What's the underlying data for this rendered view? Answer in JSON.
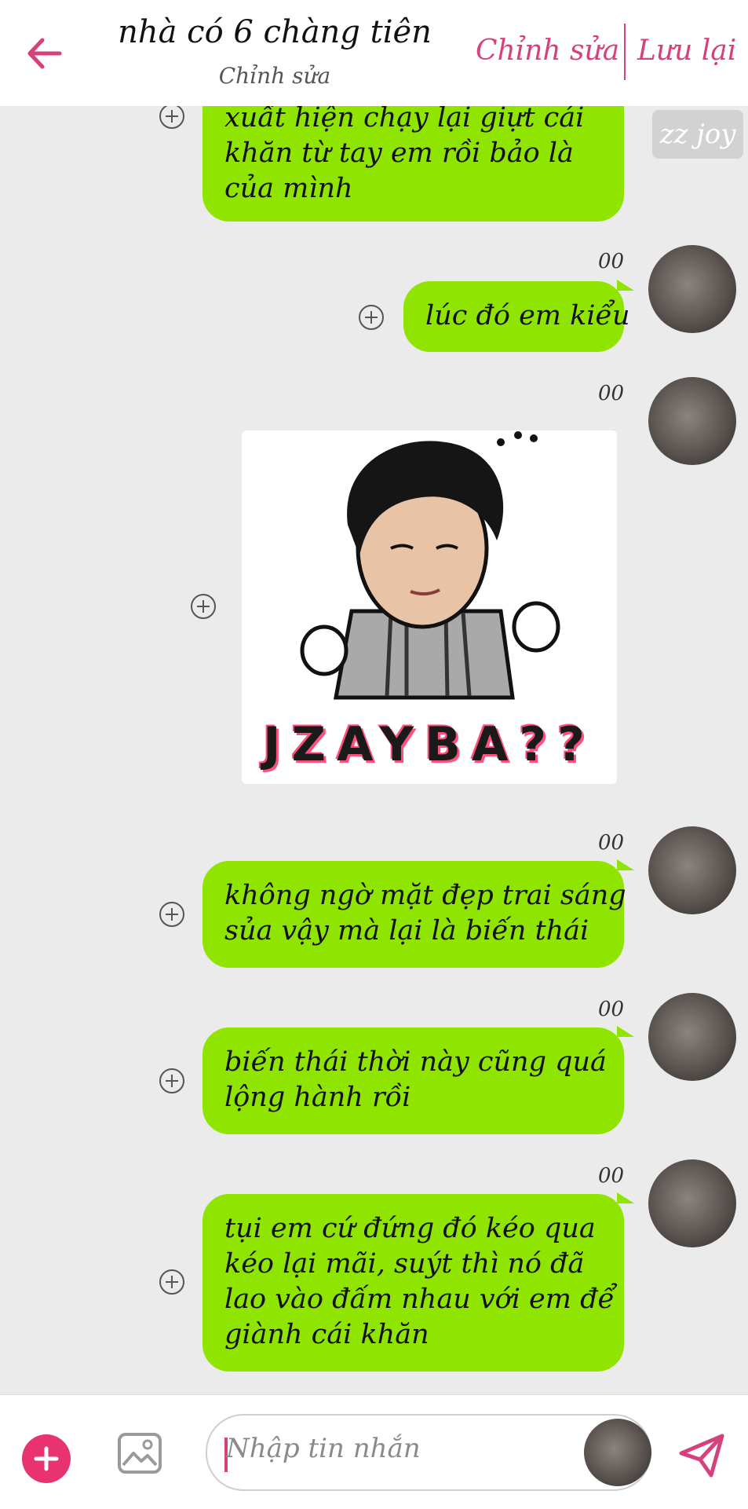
{
  "header": {
    "title": "nhà có 6 chàng tiên",
    "subtitle": "Chỉnh sửa",
    "edit_label": "Chỉnh sửa",
    "save_label": "Lưu lại",
    "accent_color": "#d6417d"
  },
  "sender_tag": "zz joy",
  "messages": [
    {
      "lines": [
        "xuất hiện chạy lại giựt cái",
        "khăn từ tay em rồi bảo là",
        "của mình"
      ]
    },
    {
      "time": "00",
      "lines": [
        "lúc đó em kiểu"
      ]
    },
    {
      "time": "00",
      "sticker_caption": "JZAYBA??"
    },
    {
      "time": "00",
      "lines": [
        "không ngờ mặt đẹp trai sáng",
        "sủa vậy mà lại là biến thái"
      ]
    },
    {
      "time": "00",
      "lines": [
        "biến thái thời này cũng quá",
        "lộng hành rồi"
      ]
    },
    {
      "time": "00",
      "lines": [
        "tụi em cứ đứng đó kéo qua",
        "kéo lại mãi, suýt thì nó đã",
        "lao vào đấm nhau với em để",
        "giành cái khăn"
      ]
    }
  ],
  "composer": {
    "placeholder": "Nhập tin nhắn"
  },
  "colors": {
    "bubble": "#8fe400",
    "background": "#ebebeb",
    "add_button": "#e83370"
  },
  "icons": [
    "back-arrow-icon",
    "add-icon",
    "image-icon",
    "send-icon"
  ]
}
